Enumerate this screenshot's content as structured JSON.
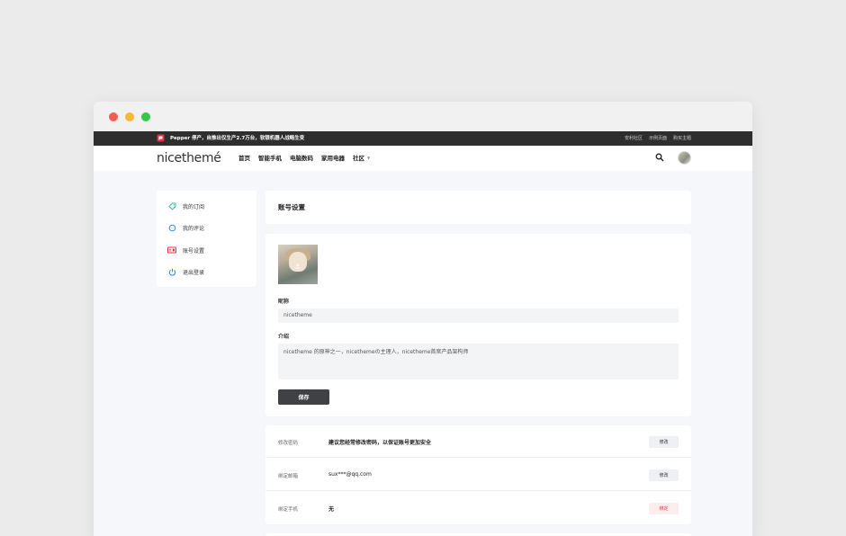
{
  "promo": {
    "text": "Pepper 停产，自推出仅生产2.7万台，软银机器人战略生变"
  },
  "top_links": [
    "安利社区",
    "示例页面",
    "购买主题"
  ],
  "brand": {
    "logo": "nicethemé"
  },
  "nav": {
    "items": [
      "首页",
      "智能手机",
      "电脑数码",
      "家用电器",
      "社区"
    ],
    "dropdown_caret": "▼"
  },
  "sidebar": {
    "items": [
      {
        "label": "我的订阅",
        "icon": "tag-icon",
        "color": "#2ec4a6"
      },
      {
        "label": "我的评论",
        "icon": "comment-icon",
        "color": "#3b86e8"
      },
      {
        "label": "账号设置",
        "icon": "id-card-icon",
        "color": "#e3333f"
      },
      {
        "label": "退出登录",
        "icon": "power-icon",
        "color": "#2f7fe0"
      }
    ]
  },
  "page": {
    "title": "账号设置"
  },
  "profile": {
    "nickname_label": "昵称",
    "nickname_value": "nicetheme",
    "intro_label": "介绍",
    "intro_value": "nicetheme 的原神之一，nicethemeの主理人，nicetheme首席产品架构师",
    "save_label": "保存"
  },
  "security": {
    "rows": [
      {
        "label": "修改密码",
        "value": "建议您经常修改密码，以保证账号更加安全",
        "action": "修改"
      },
      {
        "label": "绑定邮箱",
        "value": "sux***@qq.com",
        "action": "修改"
      },
      {
        "label": "绑定手机",
        "value": "无",
        "action": "绑定"
      }
    ]
  },
  "colors": {
    "topbar": "#2e2e2e",
    "accent_danger": "#e3333f",
    "save_button": "#3f4144"
  }
}
